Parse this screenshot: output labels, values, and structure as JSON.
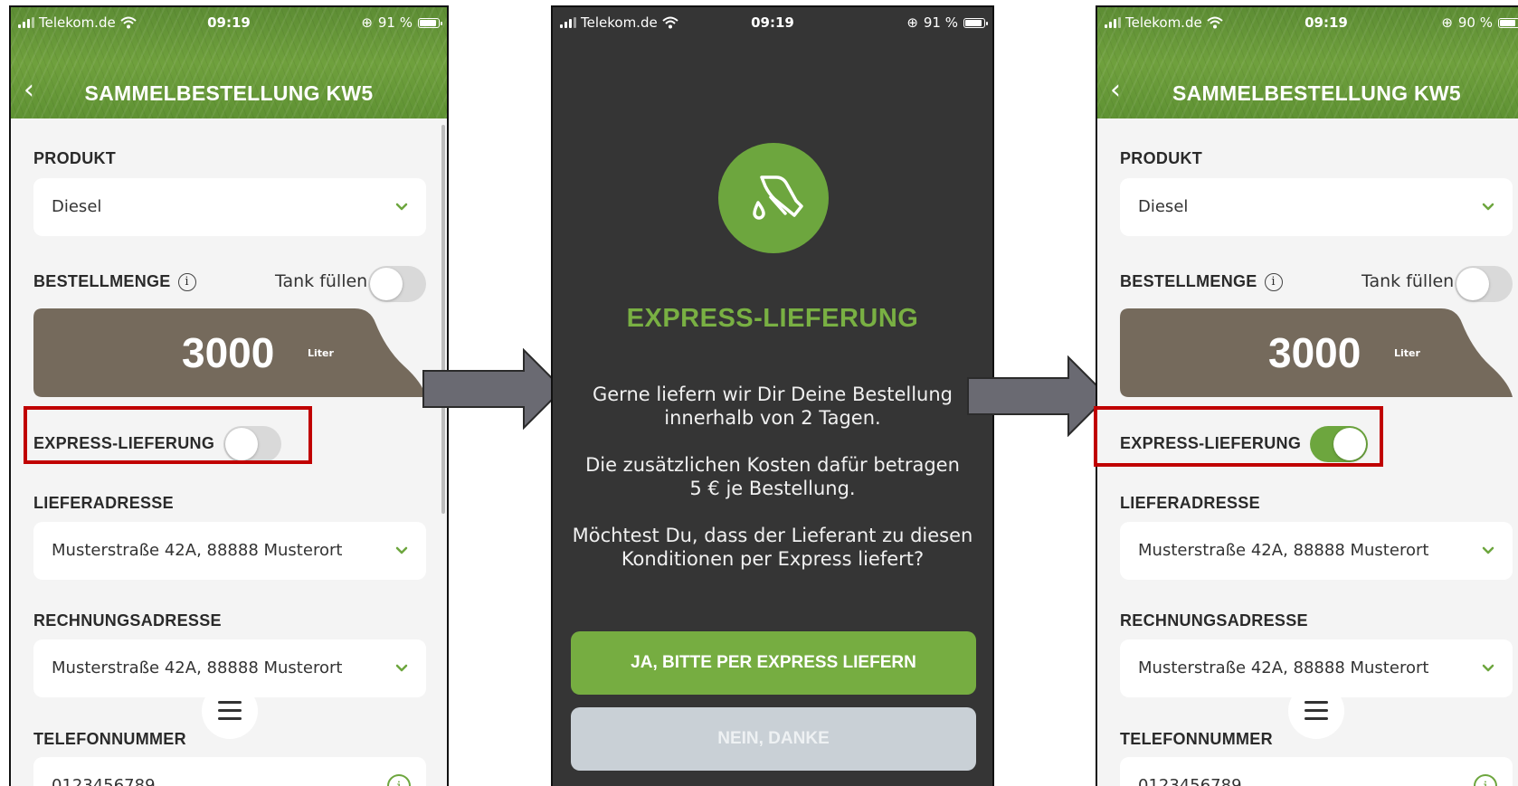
{
  "status": {
    "carrier": "Telekom.de",
    "time": "09:19",
    "battery_left": "91 %",
    "battery_right": "90 %"
  },
  "header": {
    "title": "SAMMELBESTELLUNG KW5"
  },
  "form": {
    "produkt_label": "PRODUKT",
    "produkt_value": "Diesel",
    "bestellmenge_label": "BESTELLMENGE",
    "tank_fuellen_label": "Tank füllen",
    "amount": "3000",
    "unit": "Liter",
    "express_label": "EXPRESS-LIEFERUNG",
    "lieferadresse_label": "LIEFERADRESSE",
    "lieferadresse_value": "Musterstraße 42A, 88888 Musterort",
    "rechnungsadresse_label": "RECHNUNGSADRESSE",
    "rechnungsadresse_value": "Musterstraße 42A, 88888 Musterort",
    "telefon_label": "TELEFONNUMMER",
    "telefon_value": "0123456789"
  },
  "toggles": {
    "express_before": false,
    "express_after": true,
    "tank_fuellen": false
  },
  "modal": {
    "title": "EXPRESS-LIEFERUNG",
    "text1_line1": "Gerne liefern wir Dir Deine Bestellung",
    "text1_line2": "innerhalb von 2 Tagen.",
    "text2_line1": "Die zusätzlichen Kosten dafür betragen",
    "text2_line2": "5 € je Bestellung.",
    "text3_line1": "Möchtest Du, dass der Lieferant zu diesen",
    "text3_line2": "Konditionen per Express liefert?",
    "yes_button": "JA, BITTE PER EXPRESS LIEFERN",
    "no_button": "NEIN, DANKE"
  },
  "colors": {
    "accent_green": "#6da63e",
    "header_green": "#5f9233",
    "amount_box": "#756a5c",
    "highlight_red": "#c00000",
    "modal_bg": "#353535"
  }
}
